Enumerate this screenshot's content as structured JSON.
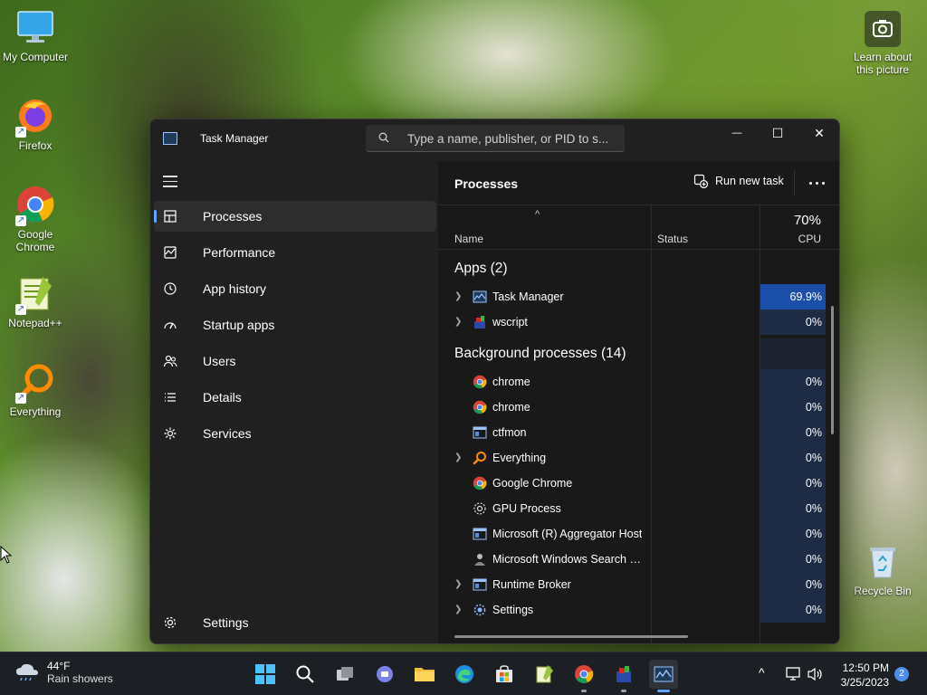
{
  "desktop": {
    "icons": [
      {
        "label": "My Computer",
        "icon": "monitor-icon"
      },
      {
        "label": "Firefox",
        "icon": "firefox-icon"
      },
      {
        "label": "Google Chrome",
        "icon": "chrome-icon"
      },
      {
        "label": "Notepad++",
        "icon": "notepadpp-icon"
      },
      {
        "label": "Everything",
        "icon": "everything-search-icon"
      },
      {
        "label": "Learn about this picture",
        "icon": "camera-icon"
      },
      {
        "label": "Recycle Bin",
        "icon": "recycle-bin-icon"
      }
    ]
  },
  "window": {
    "title": "Task Manager",
    "search_placeholder": "Type a name, publisher, or PID to s...",
    "controls": {
      "minimize": "—",
      "maximize": "☐",
      "close": "✕"
    }
  },
  "sidebar": {
    "items": [
      {
        "label": "Processes",
        "icon": "processes-icon",
        "active": true
      },
      {
        "label": "Performance",
        "icon": "performance-icon"
      },
      {
        "label": "App history",
        "icon": "history-icon"
      },
      {
        "label": "Startup apps",
        "icon": "startup-icon"
      },
      {
        "label": "Users",
        "icon": "users-icon"
      },
      {
        "label": "Details",
        "icon": "details-icon"
      },
      {
        "label": "Services",
        "icon": "services-icon"
      }
    ],
    "settings_label": "Settings"
  },
  "main": {
    "title": "Processes",
    "run_new_task": "Run new task",
    "columns": {
      "sort_arrow": "^",
      "name": "Name",
      "status": "Status",
      "cpu_total": "70%",
      "cpu": "CPU"
    },
    "apps_group": "Apps (2)",
    "apps": [
      {
        "name": "Task Manager",
        "cpu": "69.9%",
        "expandable": true,
        "icon": "task-manager-icon"
      },
      {
        "name": "wscript",
        "cpu": "0%",
        "expandable": true,
        "icon": "wscript-icon"
      }
    ],
    "background_group": "Background processes (14)",
    "background": [
      {
        "name": "chrome",
        "cpu": "0%",
        "expandable": false,
        "icon": "chrome-icon"
      },
      {
        "name": "chrome",
        "cpu": "0%",
        "expandable": false,
        "icon": "chrome-icon"
      },
      {
        "name": "ctfmon",
        "cpu": "0%",
        "expandable": false,
        "icon": "window-app-icon"
      },
      {
        "name": "Everything",
        "cpu": "0%",
        "expandable": true,
        "icon": "everything-search-icon"
      },
      {
        "name": "Google Chrome",
        "cpu": "0%",
        "expandable": false,
        "icon": "chrome-icon"
      },
      {
        "name": "GPU Process",
        "cpu": "0%",
        "expandable": false,
        "icon": "gear-icon"
      },
      {
        "name": "Microsoft (R) Aggregator Host",
        "cpu": "0%",
        "expandable": false,
        "icon": "window-app-icon"
      },
      {
        "name": "Microsoft Windows Search Pr...",
        "cpu": "0%",
        "expandable": false,
        "icon": "search-person-icon"
      },
      {
        "name": "Runtime Broker",
        "cpu": "0%",
        "expandable": true,
        "icon": "window-app-icon"
      },
      {
        "name": "Settings",
        "cpu": "0%",
        "expandable": true,
        "icon": "settings-gear-icon"
      }
    ]
  },
  "taskbar": {
    "weather_temp": "44°F",
    "weather_desc": "Rain showers",
    "clock_time": "12:50 PM",
    "clock_date": "3/25/2023",
    "notification_count": "2",
    "tray_chevron": "^"
  },
  "colors": {
    "accent": "#60a5fa",
    "cpu_hot": "#1a4ea8",
    "cpu_cell": "#1d2b45",
    "window_bg": "#202020"
  }
}
